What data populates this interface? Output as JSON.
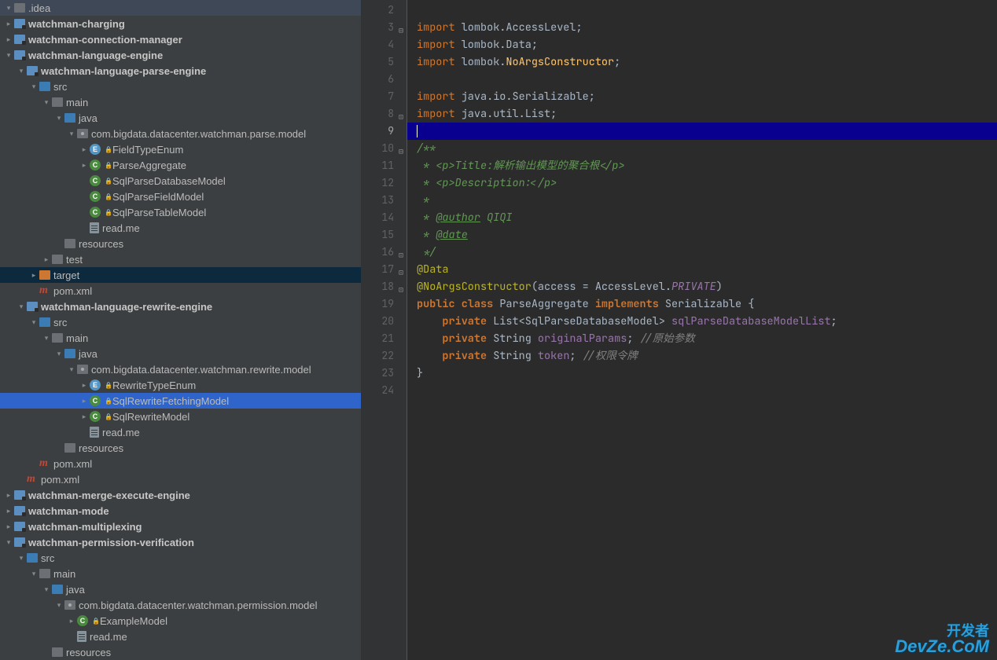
{
  "tree": [
    {
      "d": 0,
      "t": "folder-open",
      "a": "v",
      "lbl": ".idea",
      "int": true
    },
    {
      "d": 0,
      "t": "module",
      "a": ">",
      "lbl": "watchman-charging",
      "bold": true,
      "int": true
    },
    {
      "d": 0,
      "t": "module",
      "a": ">",
      "lbl": "watchman-connection-manager",
      "bold": true,
      "int": true
    },
    {
      "d": 0,
      "t": "module",
      "a": "v",
      "lbl": "watchman-language-engine",
      "bold": true,
      "int": true
    },
    {
      "d": 1,
      "t": "module",
      "a": "v",
      "lbl": "watchman-language-parse-engine",
      "bold": true,
      "int": true
    },
    {
      "d": 2,
      "t": "folder-blue",
      "a": "v",
      "lbl": "src",
      "int": true
    },
    {
      "d": 3,
      "t": "folder-open",
      "a": "v",
      "lbl": "main",
      "int": true
    },
    {
      "d": 4,
      "t": "folder-blue",
      "a": "v",
      "lbl": "java",
      "int": true
    },
    {
      "d": 5,
      "t": "pkg",
      "a": "v",
      "lbl": "com.bigdata.datacenter.watchman.parse.model",
      "int": true
    },
    {
      "d": 6,
      "t": "enum",
      "a": ">",
      "lbl": "FieldTypeEnum",
      "letter": "E",
      "lock": true,
      "int": true
    },
    {
      "d": 6,
      "t": "class",
      "a": ">",
      "lbl": "ParseAggregate",
      "letter": "C",
      "lock": true,
      "int": true
    },
    {
      "d": 6,
      "t": "class",
      "a": "",
      "lbl": "SqlParseDatabaseModel",
      "letter": "C",
      "lock": true,
      "int": true
    },
    {
      "d": 6,
      "t": "class",
      "a": "",
      "lbl": "SqlParseFieldModel",
      "letter": "C",
      "lock": true,
      "int": true
    },
    {
      "d": 6,
      "t": "class",
      "a": "",
      "lbl": "SqlParseTableModel",
      "letter": "C",
      "lock": true,
      "int": true
    },
    {
      "d": 6,
      "t": "file",
      "a": "",
      "lbl": "read.me",
      "int": true
    },
    {
      "d": 4,
      "t": "folder-gray",
      "a": "",
      "lbl": "resources",
      "int": true
    },
    {
      "d": 3,
      "t": "folder-open",
      "a": ">",
      "lbl": "test",
      "int": true
    },
    {
      "d": 2,
      "t": "folder-orange",
      "a": ">",
      "lbl": "target",
      "int": true,
      "sel": true
    },
    {
      "d": 2,
      "t": "maven",
      "a": "",
      "lbl": "pom.xml",
      "int": true
    },
    {
      "d": 1,
      "t": "module",
      "a": "v",
      "lbl": "watchman-language-rewrite-engine",
      "bold": true,
      "int": true
    },
    {
      "d": 2,
      "t": "folder-blue",
      "a": "v",
      "lbl": "src",
      "int": true
    },
    {
      "d": 3,
      "t": "folder-open",
      "a": "v",
      "lbl": "main",
      "int": true
    },
    {
      "d": 4,
      "t": "folder-blue",
      "a": "v",
      "lbl": "java",
      "int": true
    },
    {
      "d": 5,
      "t": "pkg",
      "a": "v",
      "lbl": "com.bigdata.datacenter.watchman.rewrite.model",
      "int": true
    },
    {
      "d": 6,
      "t": "enum",
      "a": ">",
      "lbl": "RewriteTypeEnum",
      "letter": "E",
      "lock": true,
      "int": true
    },
    {
      "d": 6,
      "t": "class",
      "a": ">",
      "lbl": "SqlRewriteFetchingModel",
      "letter": "C",
      "lock": true,
      "int": true,
      "hl": true
    },
    {
      "d": 6,
      "t": "class",
      "a": ">",
      "lbl": "SqlRewriteModel",
      "letter": "C",
      "lock": true,
      "int": true
    },
    {
      "d": 6,
      "t": "file",
      "a": "",
      "lbl": "read.me",
      "int": true
    },
    {
      "d": 4,
      "t": "folder-gray",
      "a": "",
      "lbl": "resources",
      "int": true
    },
    {
      "d": 2,
      "t": "maven",
      "a": "",
      "lbl": "pom.xml",
      "int": true
    },
    {
      "d": 1,
      "t": "maven",
      "a": "",
      "lbl": "pom.xml",
      "int": true
    },
    {
      "d": 0,
      "t": "module",
      "a": ">",
      "lbl": "watchman-merge-execute-engine",
      "bold": true,
      "int": true
    },
    {
      "d": 0,
      "t": "module",
      "a": ">",
      "lbl": "watchman-mode",
      "bold": true,
      "int": true
    },
    {
      "d": 0,
      "t": "module",
      "a": ">",
      "lbl": "watchman-multiplexing",
      "bold": true,
      "int": true
    },
    {
      "d": 0,
      "t": "module",
      "a": "v",
      "lbl": "watchman-permission-verification",
      "bold": true,
      "int": true
    },
    {
      "d": 1,
      "t": "folder-blue",
      "a": "v",
      "lbl": "src",
      "int": true
    },
    {
      "d": 2,
      "t": "folder-open",
      "a": "v",
      "lbl": "main",
      "int": true
    },
    {
      "d": 3,
      "t": "folder-blue",
      "a": "v",
      "lbl": "java",
      "int": true
    },
    {
      "d": 4,
      "t": "pkg",
      "a": "v",
      "lbl": "com.bigdata.datacenter.watchman.permission.model",
      "int": true
    },
    {
      "d": 5,
      "t": "class",
      "a": ">",
      "lbl": "ExampleModel",
      "letter": "C",
      "lock": true,
      "int": true
    },
    {
      "d": 5,
      "t": "file",
      "a": "",
      "lbl": "read.me",
      "int": true
    },
    {
      "d": 3,
      "t": "folder-gray",
      "a": "",
      "lbl": "resources",
      "int": true
    }
  ],
  "gutter": {
    "start": 2,
    "end": 24,
    "current": 9
  },
  "code_lines": [
    {
      "n": 2,
      "h": ""
    },
    {
      "n": 3,
      "h": "<span class='kw-n'>import</span> lombok.AccessLevel<span class='op'>;</span>",
      "fold": "⊟"
    },
    {
      "n": 4,
      "h": "<span class='kw-n'>import</span> lombok.Data<span class='op'>;</span>"
    },
    {
      "n": 5,
      "h": "<span class='kw-n'>import</span> lombok.<span class='hilite'>NoArgsConstructor</span><span class='op'>;</span>"
    },
    {
      "n": 6,
      "h": ""
    },
    {
      "n": 7,
      "h": "<span class='kw-n'>import</span> java.io.Serializable<span class='op'>;</span>"
    },
    {
      "n": 8,
      "h": "<span class='kw-n'>import</span> java.util.List<span class='op'>;</span>",
      "fold": "⊡"
    },
    {
      "n": 9,
      "h": "<span class='caret'></span>",
      "cur": true
    },
    {
      "n": 10,
      "h": "<span class='doc'>/**</span>",
      "fold": "⊟"
    },
    {
      "n": 11,
      "h": "<span class='doc'> * &lt;p&gt;Title:解析输出模型的聚合根&lt;/p&gt;</span>"
    },
    {
      "n": 12,
      "h": "<span class='doc'> * &lt;p&gt;Description:&lt;/p&gt;</span>"
    },
    {
      "n": 13,
      "h": "<span class='doc'> *</span>"
    },
    {
      "n": 14,
      "h": "<span class='doc'> * <span class='doc-tag'>@author</span> QIQI</span>"
    },
    {
      "n": 15,
      "h": "<span class='doc'> * <span class='doc-tag'>@date</span></span>"
    },
    {
      "n": 16,
      "h": "<span class='doc'> */</span>",
      "fold": "⊡"
    },
    {
      "n": 17,
      "h": "<span class='ann'>@Data</span>",
      "fold": "⊡"
    },
    {
      "n": 18,
      "h": "<span class='ann'>@NoArgsConstructor</span><span class='op'>(</span>access <span class='op'>=</span> AccessLevel.<span class='enum-const'>PRIVATE</span><span class='op'>)</span>",
      "fold": "⊡"
    },
    {
      "n": 19,
      "h": "<span class='kw'>public</span> <span class='kw'>class</span> ParseAggregate <span class='kw'>implements</span> Serializable <span class='op'>{</span>"
    },
    {
      "n": 20,
      "h": "    <span class='kw'>private</span> List<span class='op'>&lt;</span>SqlParseDatabaseModel<span class='op'>&gt;</span> <span class='field'>sqlParseDatabaseModelList</span><span class='op'>;</span>"
    },
    {
      "n": 21,
      "h": "    <span class='kw'>private</span> String <span class='field'>originalParams</span><span class='op'>;</span> <span class='cmt'>//原始参数</span>"
    },
    {
      "n": 22,
      "h": "    <span class='kw'>private</span> String <span class='field'>token</span><span class='op'>;</span> <span class='cmt'>//权限令牌</span>"
    },
    {
      "n": 23,
      "h": "<span class='op'>}</span>"
    },
    {
      "n": 24,
      "h": ""
    }
  ],
  "watermark": {
    "cn": "开发者",
    "en": "DevZe.CoM"
  }
}
